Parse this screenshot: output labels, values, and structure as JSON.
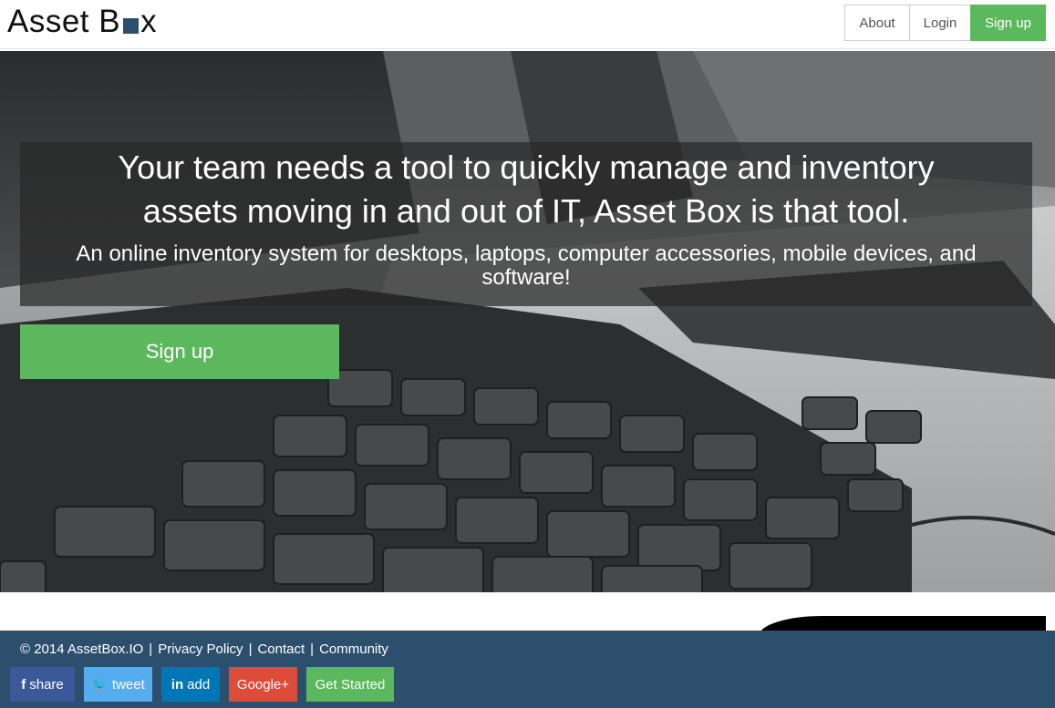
{
  "header": {
    "logo_before": "Asset B",
    "logo_after": "x",
    "nav": {
      "about": "About",
      "login": "Login",
      "signup": "Sign up"
    }
  },
  "hero": {
    "title": "Your team needs a tool to quickly manage and inventory assets moving in and out of IT, Asset Box is that tool.",
    "subtitle": "An online inventory system for desktops, laptops, computer accessories, mobile devices, and software!",
    "signup": "Sign up"
  },
  "footer": {
    "copyright": "© 2014 AssetBox.IO",
    "links": {
      "privacy": "Privacy Policy",
      "contact": "Contact",
      "community": "Community"
    },
    "separator": "|",
    "social": {
      "facebook": {
        "icon": "f",
        "label": "share"
      },
      "twitter": {
        "icon": "🐦",
        "label": "tweet"
      },
      "linkedin": {
        "icon": "in",
        "label": "add"
      },
      "google": {
        "label": "Google+"
      },
      "get_started": {
        "label": "Get Started"
      }
    }
  },
  "colors": {
    "brand_navy": "#2c4f6e",
    "green": "#5cb85c",
    "facebook": "#3b5998",
    "twitter": "#55acee",
    "linkedin": "#0077b5",
    "google": "#dd4b39"
  }
}
